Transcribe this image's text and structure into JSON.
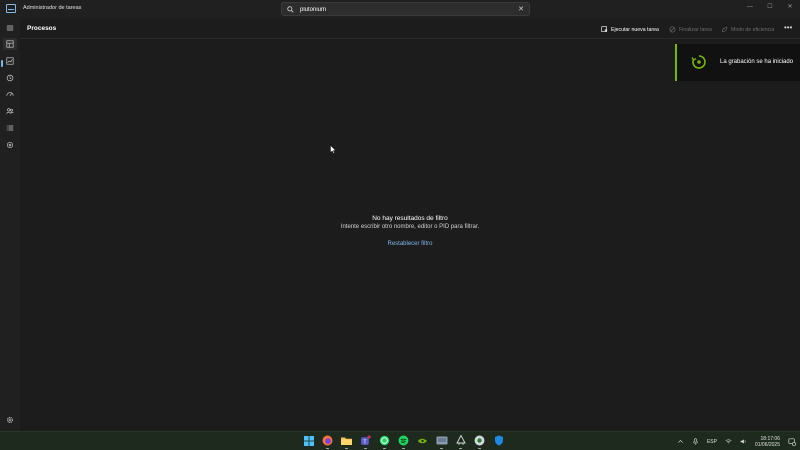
{
  "window": {
    "title": "Administrador de tareas",
    "controls": [
      "minimize-icon",
      "maximize-icon",
      "close-icon"
    ]
  },
  "search": {
    "value": "plutonium",
    "clear_label": "✕"
  },
  "nav": {
    "items": [
      {
        "name": "hamburger-menu",
        "icon": "menu-icon"
      },
      {
        "name": "procesos",
        "icon": "processes-icon",
        "active": true
      },
      {
        "name": "rendimiento",
        "icon": "performance-icon"
      },
      {
        "name": "historial-aplicaciones",
        "icon": "history-icon"
      },
      {
        "name": "aplicaciones-arranque",
        "icon": "startup-icon"
      },
      {
        "name": "usuarios",
        "icon": "users-icon"
      },
      {
        "name": "detalles",
        "icon": "details-icon"
      },
      {
        "name": "servicios",
        "icon": "services-icon"
      },
      {
        "name": "configuracion",
        "icon": "gear-icon"
      }
    ]
  },
  "cmdbar": {
    "page_title": "Procesos",
    "run_task": "Ejecutar nueva tarea",
    "end_task": "Finalizar tarea",
    "efficiency": "Modo de eficiencia",
    "more": "•••"
  },
  "empty_state": {
    "title": "No hay resultados de filtro",
    "subtitle": "Intente escribir otro nombre, editor o PID para filtrar.",
    "reset": "Restablecer filtro"
  },
  "toast": {
    "text": "La grabación se ha iniciado",
    "accent": "#76b900"
  },
  "taskbar": {
    "apps": [
      "windows-start-icon",
      "firefox-icon",
      "file-explorer-icon",
      "teams-icon",
      "whatsapp-icon",
      "spotify-icon",
      "nvidia-icon",
      "keyboard-app-icon",
      "inkscape-icon",
      "chrome-app-icon",
      "security-shield-icon"
    ],
    "tray": {
      "language": "ESP",
      "time": "18:17:06",
      "date": "01/06/2025"
    }
  },
  "colors": {
    "background": "#1c1c1c",
    "accent_link": "#7fb7e8"
  }
}
